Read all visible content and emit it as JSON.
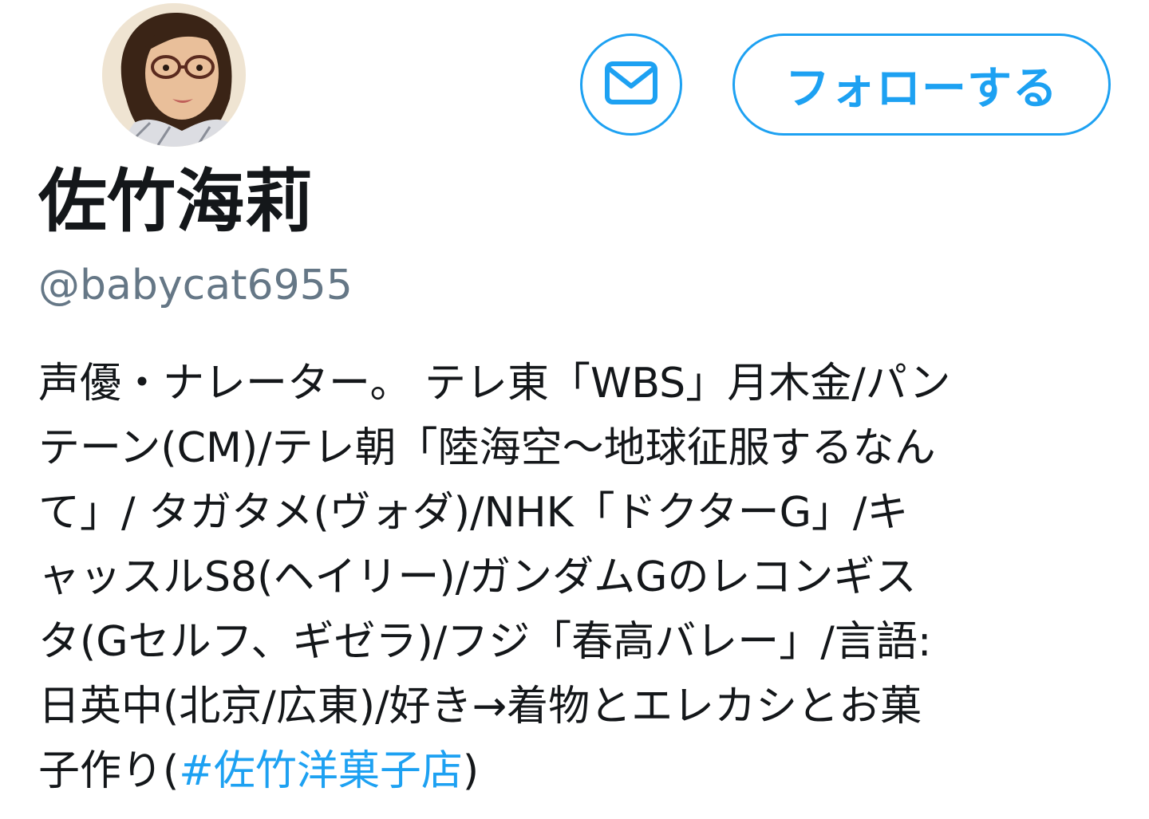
{
  "profile": {
    "display_name": "佐竹海莉",
    "handle": "@babycat6955",
    "follow_label": "フォローする",
    "bio_lines": [
      "声優・ナレーター。 テレ東「WBS」月木金/パン",
      "テーン(CM)/テレ朝「陸海空〜地球征服するなん",
      "て」/ タガタメ(ヴォダ)/NHK「ドクターG」/キ",
      "ャッスルS8(ヘイリー)/ガンダムGのレコンギス",
      "タ(Gセルフ、ギゼラ)/フジ「春高バレー」/言語:",
      "日英中(北京/広東)/好き→着物とエレカシとお菓"
    ],
    "bio_last_prefix": "子作り(",
    "bio_hashtag": "#佐竹洋菓子店",
    "bio_last_suffix": ")"
  },
  "colors": {
    "accent": "#1da1f2",
    "text_primary": "#14171a",
    "text_secondary": "#657786"
  },
  "icons": {
    "message": "envelope-icon"
  }
}
